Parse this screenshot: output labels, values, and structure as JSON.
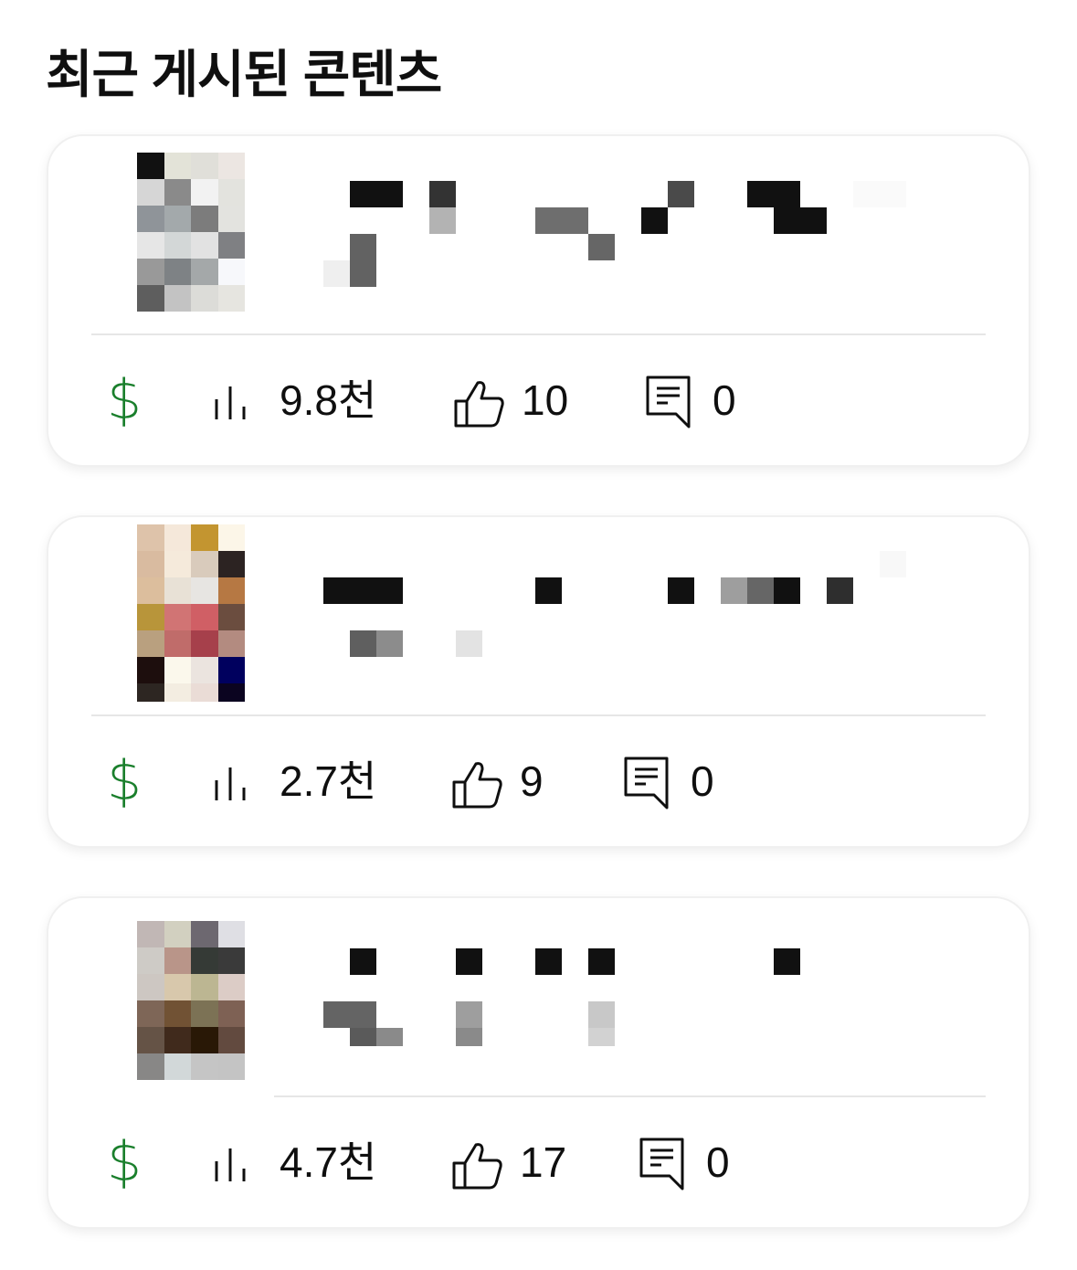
{
  "section_title": "최근 게시된 콘텐츠",
  "colors": {
    "money_icon": "#1a7f2c",
    "text": "#0f0f0f",
    "divider": "#e6e6e6"
  },
  "icons": {
    "revenue": "dollar-icon",
    "views": "bar-chart-icon",
    "likes": "thumbs-up-icon",
    "comments": "comment-icon"
  },
  "cards": [
    {
      "views": "9.8천",
      "likes": "10",
      "comments": "0"
    },
    {
      "views": "2.7천",
      "likes": "9",
      "comments": "0"
    },
    {
      "views": "4.7천",
      "likes": "17",
      "comments": "0"
    }
  ]
}
